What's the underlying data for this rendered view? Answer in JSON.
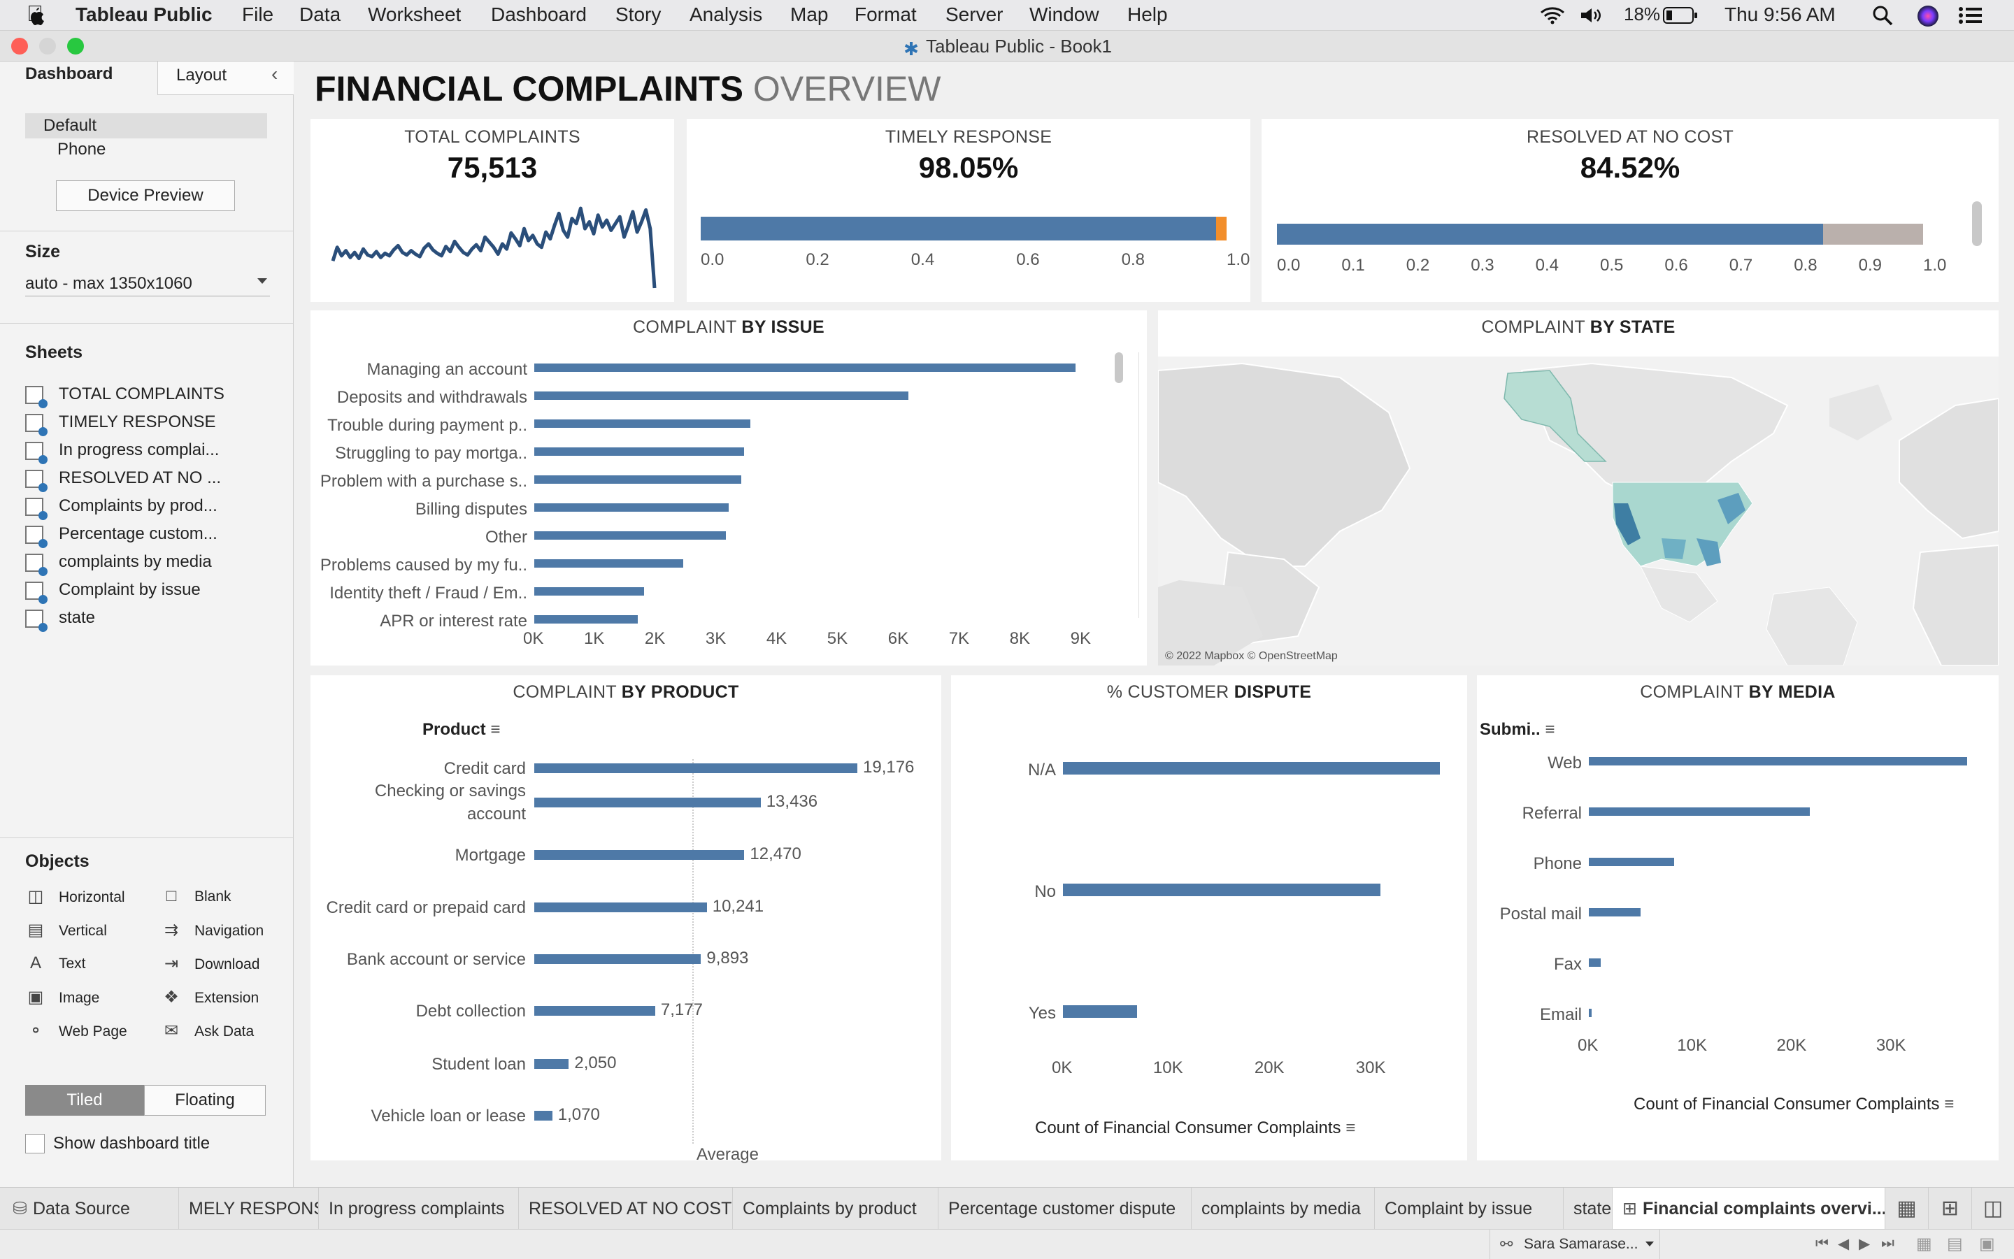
{
  "menubar": {
    "app": "Tableau Public",
    "items": [
      "File",
      "Data",
      "Worksheet",
      "Dashboard",
      "Story",
      "Analysis",
      "Map",
      "Format",
      "Server",
      "Window",
      "Help"
    ],
    "battery": "18%",
    "clock": "Thu 9:56 AM"
  },
  "window_title": "Tableau Public - Book1",
  "sidebar": {
    "tab_dashboard": "Dashboard",
    "tab_layout": "Layout",
    "device_default": "Default",
    "device_phone": "Phone",
    "device_preview": "Device Preview",
    "size_title": "Size",
    "size_value": "auto - max 1350x1060",
    "sheets_title": "Sheets",
    "sheets": [
      "TOTAL COMPLAINTS",
      "TIMELY RESPONSE",
      "In progress complai...",
      "RESOLVED AT NO ...",
      "Complaints by prod...",
      "Percentage custom...",
      "complaints by media",
      "Complaint by issue",
      "state"
    ],
    "objects_title": "Objects",
    "objects_left": [
      "Horizontal",
      "Vertical",
      "Text",
      "Image",
      "Web Page"
    ],
    "objects_right": [
      "Blank",
      "Navigation",
      "Download",
      "Extension",
      "Ask Data"
    ],
    "tiled": "Tiled",
    "floating": "Floating",
    "show_title": "Show dashboard title"
  },
  "dashboard": {
    "title_bold": "FINANCIAL COMPLAINTS",
    "title_light": "OVERVIEW",
    "kpi_total": {
      "title": "TOTAL COMPLAINTS",
      "value": "75,513"
    },
    "kpi_timely": {
      "title": "TIMELY RESPONSE",
      "value": "98.05%",
      "fraction": 0.9805,
      "ticks": [
        "0.0",
        "0.2",
        "0.4",
        "0.6",
        "0.8",
        "1.0"
      ]
    },
    "kpi_resolved": {
      "title": "RESOLVED AT NO COST",
      "value": "84.52%",
      "fraction": 0.8452,
      "ticks": [
        "0.0",
        "0.1",
        "0.2",
        "0.3",
        "0.4",
        "0.5",
        "0.6",
        "0.7",
        "0.8",
        "0.9",
        "1.0"
      ]
    },
    "issue_title_light": "COMPLAINT",
    "issue_title_bold": "BY ISSUE",
    "state_title_light": "COMPLAINT",
    "state_title_bold": "BY STATE",
    "map_attribution": "© 2022 Mapbox © OpenStreetMap",
    "product_title_light": "COMPLAINT",
    "product_title_bold": "BY PRODUCT",
    "product_header": "Product",
    "product_avg_label": "Average",
    "dispute_title_light": "% CUSTOMER",
    "dispute_title_bold": "DISPUTE",
    "dispute_axis_title": "Count of Financial Consumer Complaints",
    "media_title_light": "COMPLAINT",
    "media_title_bold": "BY MEDIA",
    "media_header": "Submi..",
    "media_axis_title": "Count of Financial Consumer Complaints"
  },
  "chart_data": [
    {
      "type": "line",
      "name": "TOTAL COMPLAINTS sparkline",
      "values": [
        2,
        18,
        8,
        14,
        6,
        12,
        5,
        16,
        9,
        7,
        13,
        6,
        11,
        8,
        15,
        20,
        12,
        9,
        14,
        10,
        7,
        17,
        22,
        15,
        11,
        8,
        19,
        13,
        25,
        18,
        12,
        9,
        16,
        21,
        14,
        30,
        24,
        18,
        10,
        22,
        16,
        35,
        28,
        20,
        40,
        26,
        32,
        22,
        18,
        36,
        28,
        44,
        58,
        38,
        30,
        52,
        46,
        64,
        40,
        48,
        34,
        56,
        42,
        50,
        38,
        46,
        54,
        30,
        44,
        60,
        36,
        48,
        62,
        40,
        -30
      ],
      "title": "TOTAL COMPLAINTS"
    },
    {
      "type": "bar",
      "title": "COMPLAINT BY ISSUE",
      "categories": [
        "Managing an account",
        "Deposits and withdrawals",
        "Trouble during payment p..",
        "Struggling to pay mortga..",
        "Problem with a purchase s..",
        "Billing disputes",
        "Other",
        "Problems caused by my fu..",
        "Identity theft / Fraud / Em..",
        "APR or interest rate"
      ],
      "values": [
        8900,
        6150,
        3550,
        3450,
        3400,
        3200,
        3150,
        2450,
        1800,
        1700
      ],
      "xticks": [
        "0K",
        "1K",
        "2K",
        "3K",
        "4K",
        "5K",
        "6K",
        "7K",
        "8K",
        "9K"
      ],
      "xlim": [
        0,
        9200
      ]
    },
    {
      "type": "bar",
      "title": "COMPLAINT BY PRODUCT",
      "categories": [
        "Credit card",
        "Checking or savings account",
        "Mortgage",
        "Credit card or prepaid card",
        "Bank account or service",
        "Debt collection",
        "Student loan",
        "Vehicle loan or lease"
      ],
      "values": [
        19176,
        13436,
        12470,
        10241,
        9893,
        7177,
        2050,
        1070
      ],
      "labels": [
        "19,176",
        "13,436",
        "12,470",
        "10,241",
        "9,893",
        "7,177",
        "2,050",
        "1,070"
      ],
      "xlim": [
        0,
        20000
      ]
    },
    {
      "type": "bar",
      "title": "% CUSTOMER DISPUTE",
      "categories": [
        "N/A",
        "No",
        "Yes"
      ],
      "values": [
        37200,
        31300,
        7300
      ],
      "xticks": [
        "0K",
        "10K",
        "20K",
        "30K"
      ],
      "xlim": [
        0,
        38500
      ],
      "xlabel": "Count of Financial Consumer Complaints"
    },
    {
      "type": "bar",
      "title": "COMPLAINT BY MEDIA",
      "categories": [
        "Web",
        "Referral",
        "Phone",
        "Postal mail",
        "Fax",
        "Email"
      ],
      "values": [
        38000,
        22200,
        8600,
        5200,
        1200,
        250
      ],
      "xticks": [
        "0K",
        "10K",
        "20K",
        "30K"
      ],
      "xlim": [
        0,
        39500
      ],
      "xlabel": "Count of Financial Consumer Complaints"
    }
  ],
  "tabs": {
    "data_source": "Data Source",
    "sheets": [
      "MELY RESPONSE",
      "In progress complaints",
      "RESOLVED AT NO COST",
      "Complaints by product",
      "Percentage customer dispute",
      "complaints by media",
      "Complaint by issue",
      "state"
    ],
    "active": "Financial complaints overvi..."
  },
  "status": {
    "user": "Sara Samarase..."
  },
  "colors": {
    "bar": "#4e79a7",
    "accent": "#f28e2b",
    "bar_rest": "#bab0ac",
    "map_fill": "#a9d7cf"
  }
}
